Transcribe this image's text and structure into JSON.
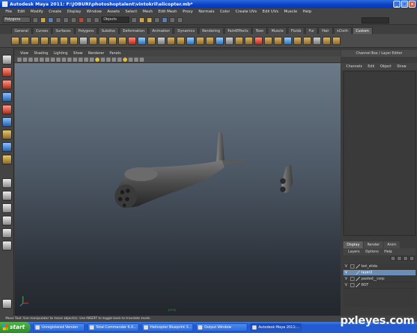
{
  "window": {
    "title": "Autodesk Maya 2011: F:\\JOBURI\\photoshoptalent\\vintokril\\elicopter.mb*"
  },
  "menubar": [
    "File",
    "Edit",
    "Modify",
    "Create",
    "Display",
    "Window",
    "Assets",
    "Select",
    "Mesh",
    "Edit Mesh",
    "Proxy",
    "Normals",
    "Color",
    "Create UVs",
    "Edit UVs",
    "Muscle",
    "Help"
  ],
  "statusline": {
    "mode": "Polygons",
    "objects_label": "Objects"
  },
  "shelf_tabs": [
    "General",
    "Curves",
    "Surfaces",
    "Polygons",
    "Subdivs",
    "Deformation",
    "Animation",
    "Dynamics",
    "Rendering",
    "PaintEffects",
    "Toon",
    "Muscle",
    "Fluids",
    "Fur",
    "Hair",
    "nCloth",
    "Custom"
  ],
  "shelf_active": "Custom",
  "panel_menu": [
    "View",
    "Shading",
    "Lighting",
    "Show",
    "Renderer",
    "Panels"
  ],
  "viewport": {
    "camera_label": "persp"
  },
  "channel_box": {
    "header": "Channel Box / Layer Editor",
    "menu": [
      "Channels",
      "Edit",
      "Object",
      "Show"
    ]
  },
  "layer_editor": {
    "tabs": [
      "Display",
      "Render",
      "Anim"
    ],
    "menu": [
      "Layers",
      "Options",
      "Help"
    ],
    "layers": [
      {
        "vis": "V",
        "name": "bot_stida",
        "selected": false
      },
      {
        "vis": "V",
        "name": "layer2",
        "selected": true
      },
      {
        "vis": "V",
        "name": "pasted__corp",
        "selected": false
      },
      {
        "vis": "V",
        "name": "BOT",
        "selected": false
      }
    ]
  },
  "helpline": "Move Tool: Use manipulator to move object(s). Use INSERT to toggle back to translate mode.",
  "taskbar": {
    "start": "start",
    "tasks": [
      {
        "label": "Unregistered Version",
        "active": false
      },
      {
        "label": "Total Commander 6.0...",
        "active": false
      },
      {
        "label": "Helicopter Blueprint 3...",
        "active": false
      },
      {
        "label": "Output Window",
        "active": false
      },
      {
        "label": "Autodesk Maya 2011:...",
        "active": true
      }
    ]
  },
  "watermark": "pxleyes.com"
}
